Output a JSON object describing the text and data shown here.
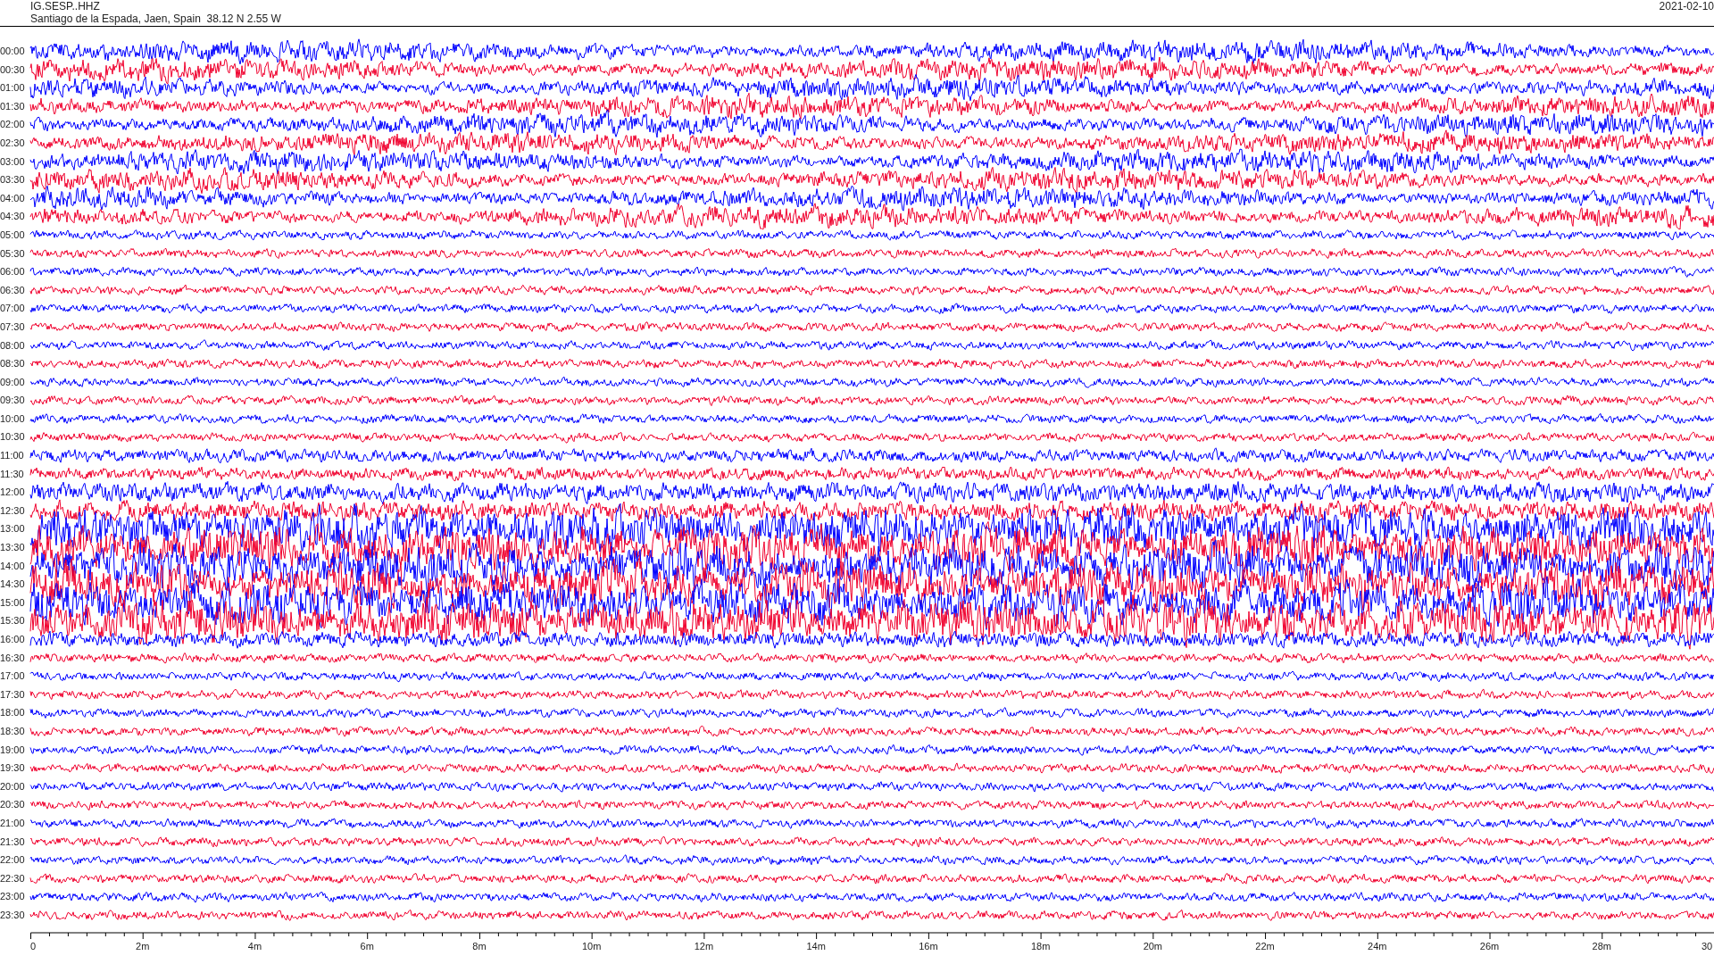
{
  "header": {
    "station": "IG.SESP..HHZ",
    "location": "Santiago de la Espada, Jaen, Spain  38.12 N 2.55 W",
    "date": "2021-02-10"
  },
  "traces": [
    {
      "label": "00:00",
      "color": "#0000ff"
    },
    {
      "label": "00:30",
      "color": "#f0002d"
    },
    {
      "label": "01:00",
      "color": "#0000ff"
    },
    {
      "label": "01:30",
      "color": "#f0002d"
    },
    {
      "label": "02:00",
      "color": "#0000ff"
    },
    {
      "label": "02:30",
      "color": "#f0002d"
    },
    {
      "label": "03:00",
      "color": "#0000ff"
    },
    {
      "label": "03:30",
      "color": "#f0002d"
    },
    {
      "label": "04:00",
      "color": "#0000ff"
    },
    {
      "label": "04:30",
      "color": "#f0002d"
    },
    {
      "label": "05:00",
      "color": "#0000ff"
    },
    {
      "label": "05:30",
      "color": "#f0002d"
    },
    {
      "label": "06:00",
      "color": "#0000ff"
    },
    {
      "label": "06:30",
      "color": "#f0002d"
    },
    {
      "label": "07:00",
      "color": "#0000ff"
    },
    {
      "label": "07:30",
      "color": "#f0002d"
    },
    {
      "label": "08:00",
      "color": "#0000ff"
    },
    {
      "label": "08:30",
      "color": "#f0002d"
    },
    {
      "label": "09:00",
      "color": "#0000ff"
    },
    {
      "label": "09:30",
      "color": "#f0002d"
    },
    {
      "label": "10:00",
      "color": "#0000ff"
    },
    {
      "label": "10:30",
      "color": "#f0002d"
    },
    {
      "label": "11:00",
      "color": "#0000ff"
    },
    {
      "label": "11:30",
      "color": "#f0002d"
    },
    {
      "label": "12:00",
      "color": "#0000ff"
    },
    {
      "label": "12:30",
      "color": "#f0002d"
    },
    {
      "label": "13:00",
      "color": "#0000ff"
    },
    {
      "label": "13:30",
      "color": "#f0002d"
    },
    {
      "label": "14:00",
      "color": "#0000ff"
    },
    {
      "label": "14:30",
      "color": "#f0002d"
    },
    {
      "label": "15:00",
      "color": "#0000ff"
    },
    {
      "label": "15:30",
      "color": "#f0002d"
    },
    {
      "label": "16:00",
      "color": "#0000ff"
    },
    {
      "label": "16:30",
      "color": "#f0002d"
    },
    {
      "label": "17:00",
      "color": "#0000ff"
    },
    {
      "label": "17:30",
      "color": "#f0002d"
    },
    {
      "label": "18:00",
      "color": "#0000ff"
    },
    {
      "label": "18:30",
      "color": "#f0002d"
    },
    {
      "label": "19:00",
      "color": "#0000ff"
    },
    {
      "label": "19:30",
      "color": "#f0002d"
    },
    {
      "label": "20:00",
      "color": "#0000ff"
    },
    {
      "label": "20:30",
      "color": "#f0002d"
    },
    {
      "label": "21:00",
      "color": "#0000ff"
    },
    {
      "label": "21:30",
      "color": "#f0002d"
    },
    {
      "label": "22:00",
      "color": "#0000ff"
    },
    {
      "label": "22:30",
      "color": "#f0002d"
    },
    {
      "label": "23:00",
      "color": "#0000ff"
    },
    {
      "label": "23:30",
      "color": "#f0002d"
    }
  ],
  "x_axis": {
    "ticks": [
      "0",
      "2m",
      "4m",
      "6m",
      "8m",
      "10m",
      "12m",
      "14m",
      "16m",
      "18m",
      "20m",
      "22m",
      "24m",
      "26m",
      "28m",
      "30"
    ]
  }
}
